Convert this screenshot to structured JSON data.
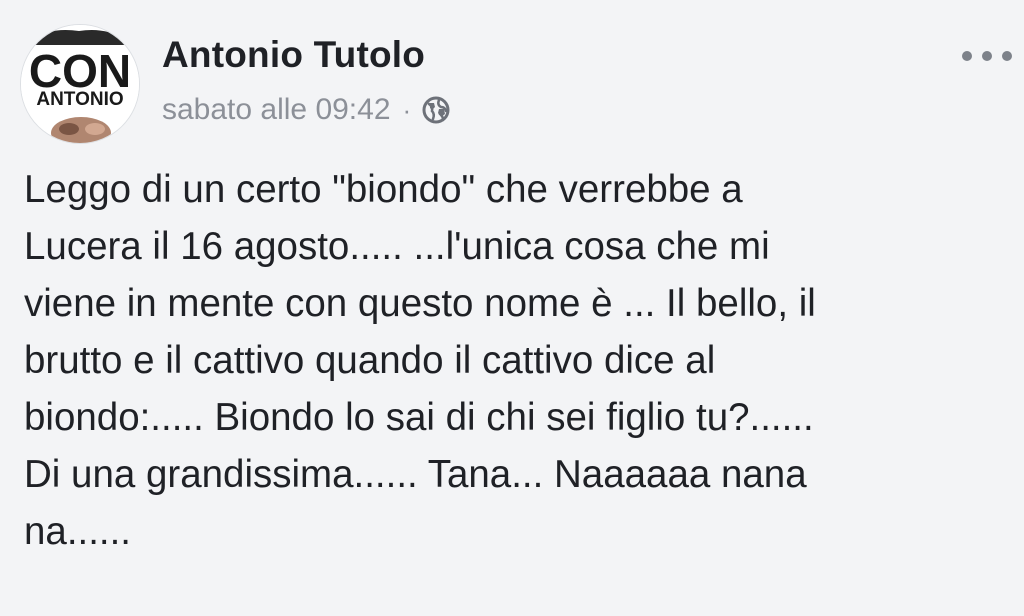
{
  "post": {
    "avatar_text": [
      "CON",
      "ANTONIO"
    ],
    "author": "Antonio Tutolo",
    "timestamp": "sabato alle 09:42",
    "separator": "·",
    "privacy_icon": "globe-icon",
    "more_icon": "more-options-icon",
    "lines": [
      "Leggo di un certo \"biondo\" che verrebbe a",
      "Lucera il 16 agosto..... ...l'unica cosa che mi",
      "viene in mente con questo nome è ... Il bello, il",
      "brutto e il cattivo quando il cattivo dice al",
      "biondo:..... Biondo lo sai di chi sei figlio tu?......",
      "Di una grandissima...... Tana... Naaaaaa nana",
      "na......"
    ]
  },
  "colors": {
    "background": "#f3f4f6",
    "text": "#1f2126",
    "meta": "#8c9098"
  }
}
